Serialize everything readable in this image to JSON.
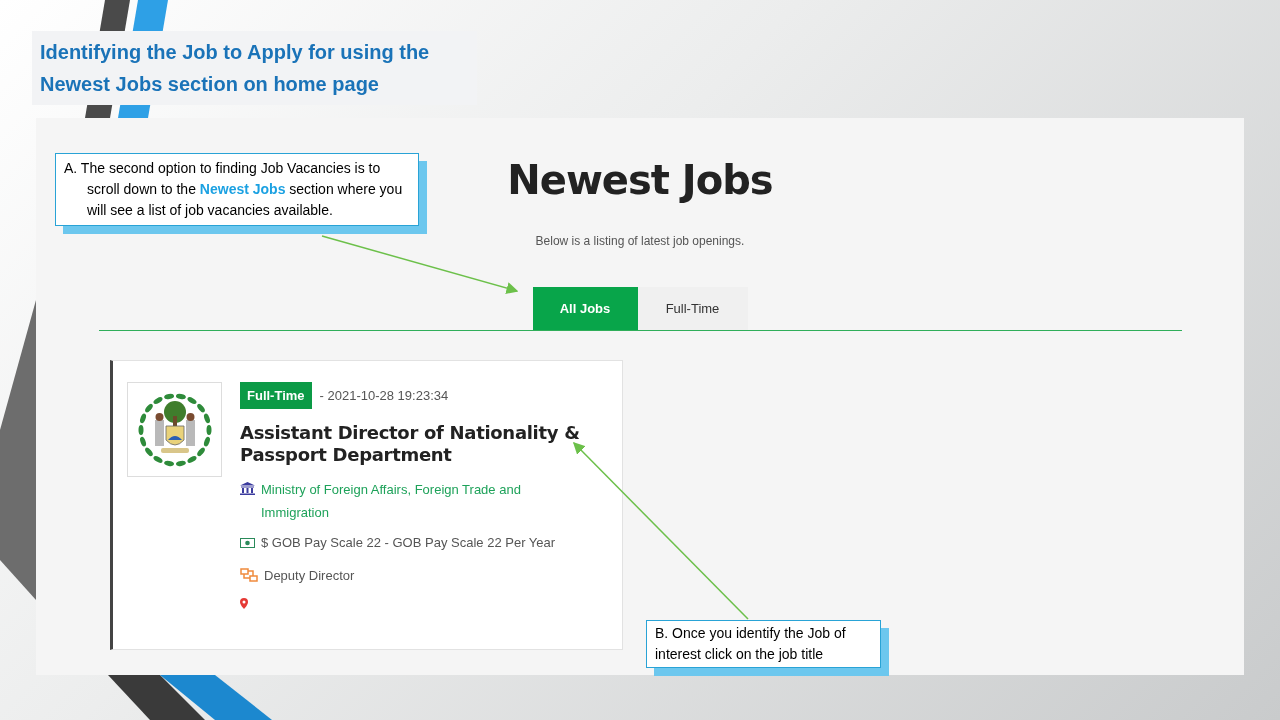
{
  "slide_title": [
    "Identifying the Job to Apply for using the",
    "Newest Jobs section on home page"
  ],
  "page": {
    "heading": "Newest Jobs",
    "subtitle": "Below is a listing of latest job openings.",
    "tabs": [
      {
        "label": "All Jobs",
        "selected": true
      },
      {
        "label": "Full-Time",
        "selected": false
      }
    ],
    "job": {
      "tag": "Full-Time",
      "date": "- 2021-10-28 19:23:34",
      "title": "Assistant Director of Nationality & Passport Department",
      "ministry": "Ministry of Foreign Affairs, Foreign Trade and Immigration",
      "salary": "$ GOB Pay Scale 22 - GOB Pay Scale 22 Per Year",
      "position": "Deputy Director"
    }
  },
  "callouts": [
    {
      "text": "A. The second option to finding Job Vacancies is to scroll down to the **Newest Jobs** section where you will see a list of job vacancies available."
    },
    {
      "text": "B. Once you identify the Job of interest click on the job title"
    }
  ]
}
